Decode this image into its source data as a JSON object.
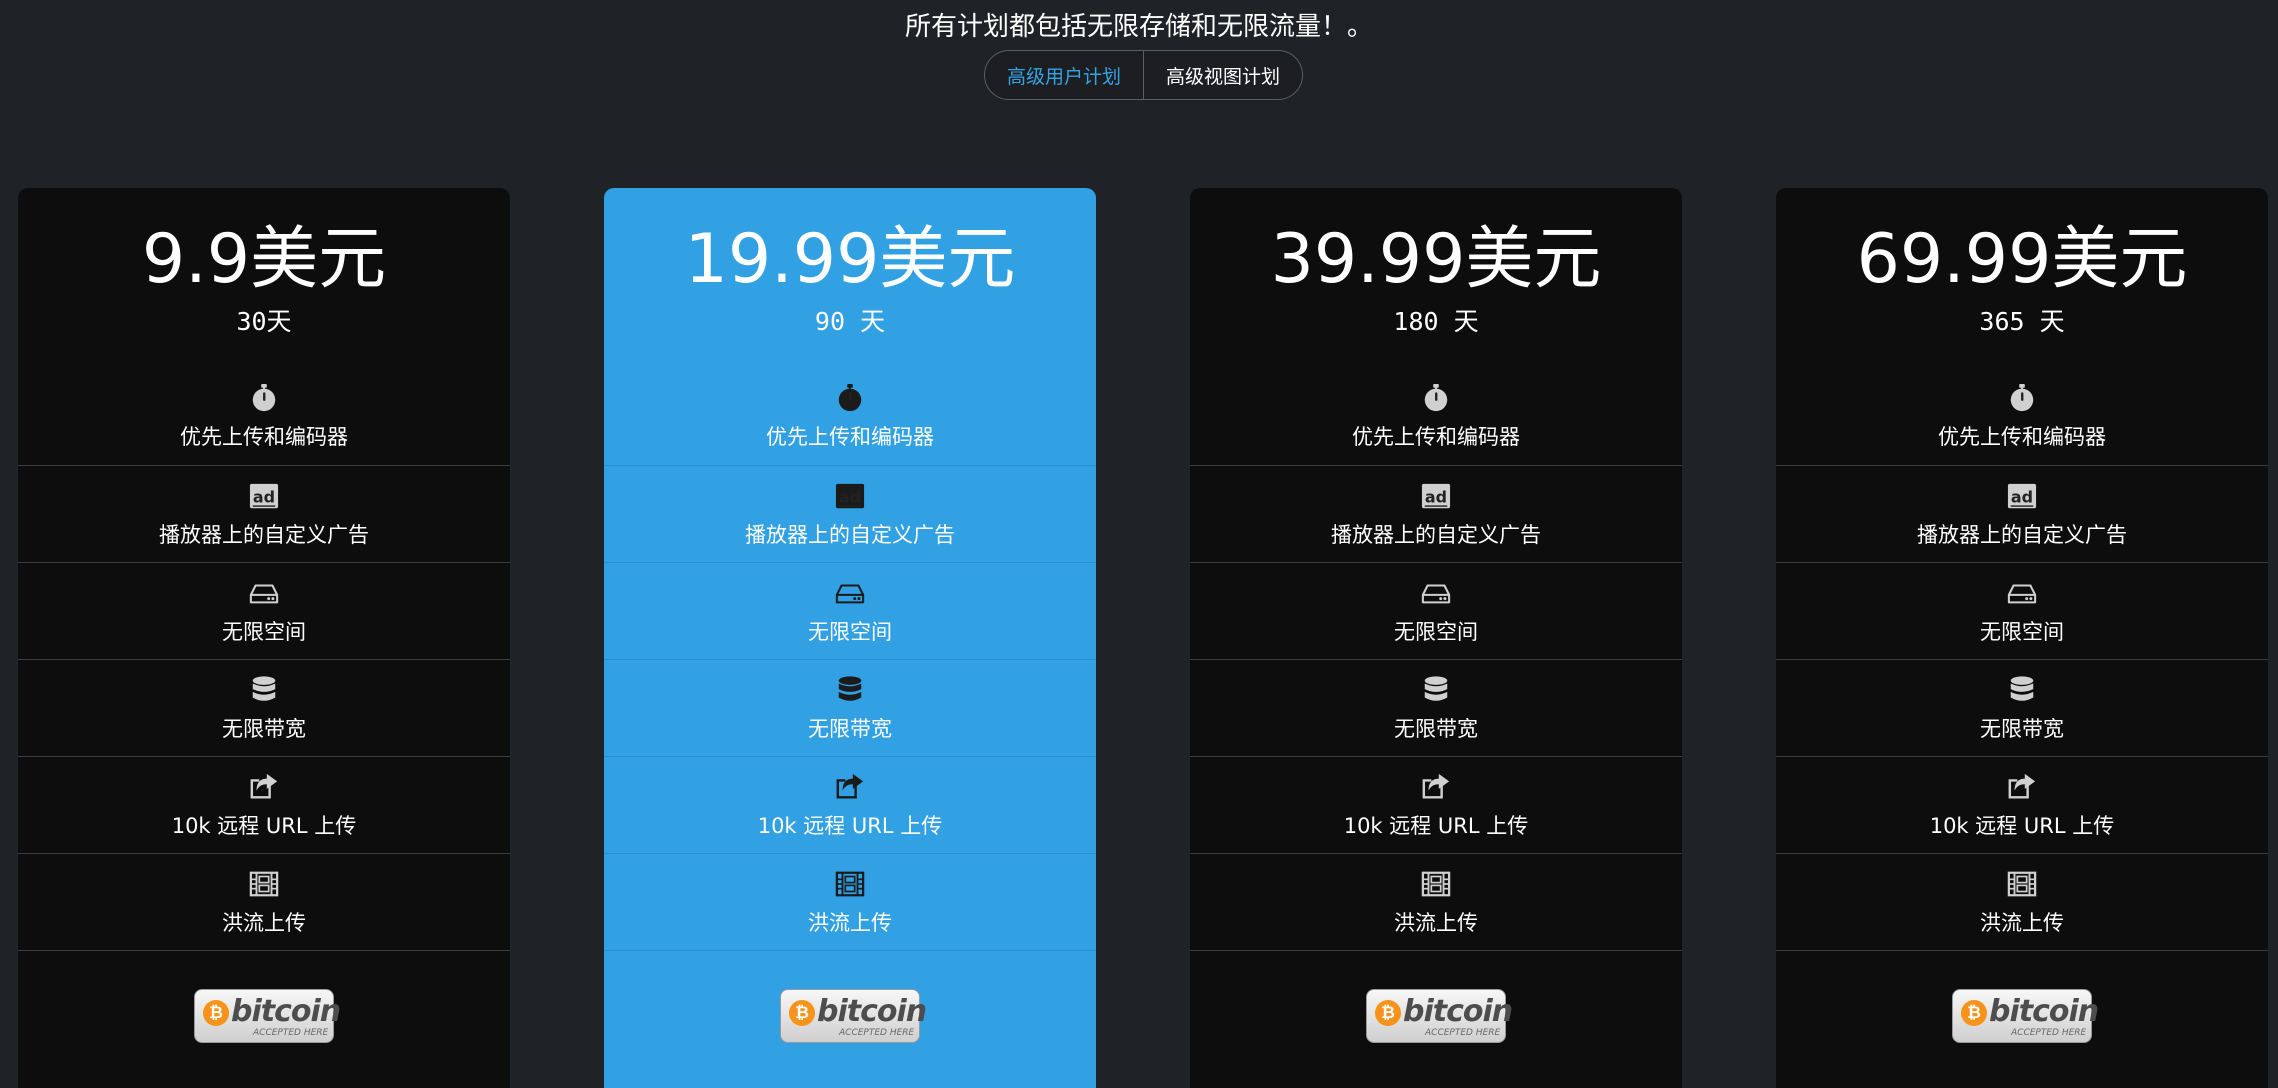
{
  "header": {
    "headline": "所有计划都包括无限存储和无限流量！。",
    "toggle": {
      "active_label": "高级用户计划",
      "inactive_label": "高级视图计划"
    }
  },
  "colors": {
    "background": "#1f2227",
    "card": "#0d0d0d",
    "highlight_card": "#31a1e4",
    "accent": "#36a3e3"
  },
  "plans": [
    {
      "price": "9.9美元",
      "duration": "30天",
      "features": [
        {
          "icon": "stopwatch-icon",
          "label": "优先上传和编码器"
        },
        {
          "icon": "ad-icon",
          "label": "播放器上的自定义广告"
        },
        {
          "icon": "hard-drive-icon",
          "label": "无限空间"
        },
        {
          "icon": "database-icon",
          "label": "无限带宽"
        },
        {
          "icon": "share-icon",
          "label": "10k 远程 URL 上传"
        },
        {
          "icon": "film-icon",
          "label": "洪流上传"
        }
      ],
      "badge": {
        "word": "bitcoin",
        "sub": "ACCEPTED HERE"
      }
    },
    {
      "price": "19.99美元",
      "duration": "90 天",
      "features": [
        {
          "icon": "stopwatch-icon",
          "label": "优先上传和编码器"
        },
        {
          "icon": "ad-icon",
          "label": "播放器上的自定义广告"
        },
        {
          "icon": "hard-drive-icon",
          "label": "无限空间"
        },
        {
          "icon": "database-icon",
          "label": "无限带宽"
        },
        {
          "icon": "share-icon",
          "label": "10k 远程 URL 上传"
        },
        {
          "icon": "film-icon",
          "label": "洪流上传"
        }
      ],
      "badge": {
        "word": "bitcoin",
        "sub": "ACCEPTED HERE"
      }
    },
    {
      "price": "39.99美元",
      "duration": "180 天",
      "features": [
        {
          "icon": "stopwatch-icon",
          "label": "优先上传和编码器"
        },
        {
          "icon": "ad-icon",
          "label": "播放器上的自定义广告"
        },
        {
          "icon": "hard-drive-icon",
          "label": "无限空间"
        },
        {
          "icon": "database-icon",
          "label": "无限带宽"
        },
        {
          "icon": "share-icon",
          "label": "10k 远程 URL 上传"
        },
        {
          "icon": "film-icon",
          "label": "洪流上传"
        }
      ],
      "badge": {
        "word": "bitcoin",
        "sub": "ACCEPTED HERE"
      }
    },
    {
      "price": "69.99美元",
      "duration": "365 天",
      "features": [
        {
          "icon": "stopwatch-icon",
          "label": "优先上传和编码器"
        },
        {
          "icon": "ad-icon",
          "label": "播放器上的自定义广告"
        },
        {
          "icon": "hard-drive-icon",
          "label": "无限空间"
        },
        {
          "icon": "database-icon",
          "label": "无限带宽"
        },
        {
          "icon": "share-icon",
          "label": "10k 远程 URL 上传"
        },
        {
          "icon": "film-icon",
          "label": "洪流上传"
        }
      ],
      "badge": {
        "word": "bitcoin",
        "sub": "ACCEPTED HERE"
      }
    }
  ]
}
